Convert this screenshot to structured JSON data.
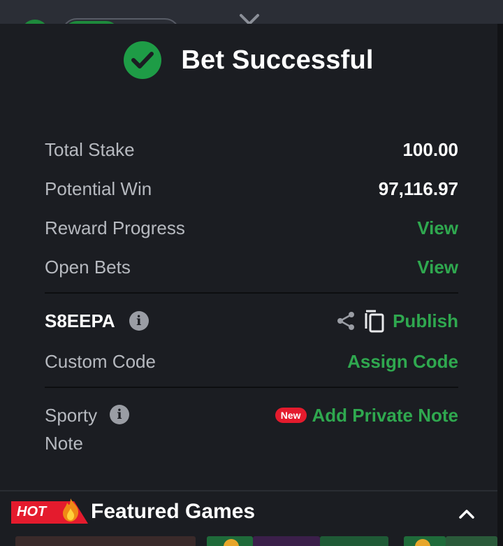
{
  "header": {
    "title": "Bet Successful"
  },
  "summary": [
    {
      "label": "Total Stake",
      "value": "100.00",
      "kind": "value"
    },
    {
      "label": "Potential Win",
      "value": "97,116.97",
      "kind": "value"
    },
    {
      "label": "Reward Progress",
      "value": "View",
      "kind": "link"
    },
    {
      "label": "Open Bets",
      "value": "View",
      "kind": "link"
    }
  ],
  "booking": {
    "code": "S8EEPA",
    "publish_label": "Publish"
  },
  "custom_code": {
    "label": "Custom Code",
    "action": "Assign Code"
  },
  "note": {
    "label_line1": "Sporty",
    "label_line2": "Note",
    "badge": "New",
    "action": "Add Private Note"
  },
  "featured": {
    "badge": "HOT",
    "title": "Featured Games"
  },
  "colors": {
    "accent_green": "#2fa84f",
    "success_green": "#1e9c46",
    "badge_red": "#e41b2d",
    "background": "#1b1d22"
  },
  "icons": [
    "check-icon",
    "info-icon",
    "share-icon",
    "copy-icon",
    "flame-icon",
    "chevron-up-icon",
    "close-icon"
  ]
}
